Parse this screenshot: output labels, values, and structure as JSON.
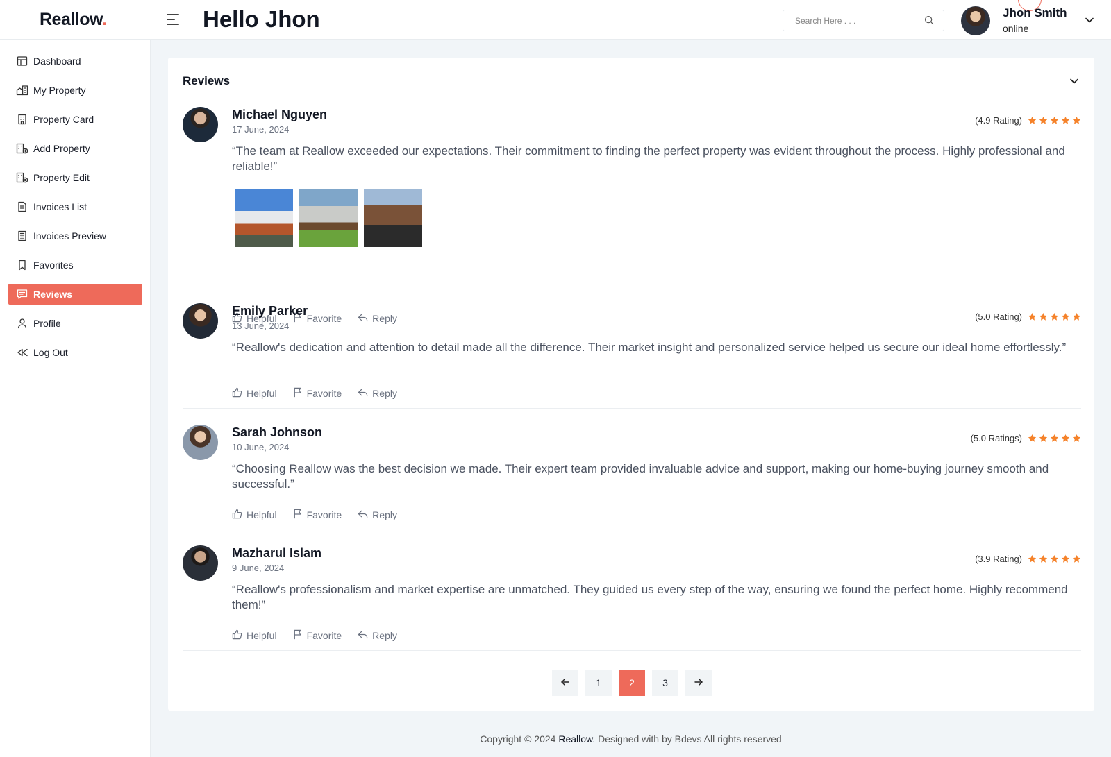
{
  "brand": {
    "name": "Reallow",
    "dot": ".",
    "accent": "#ee6a5a"
  },
  "header": {
    "title": "Hello Jhon",
    "search_placeholder": "Search Here . . .",
    "user_name": "Jhon Smith",
    "user_status": "online"
  },
  "sidebar": {
    "items": [
      {
        "label": "Dashboard",
        "icon": "dashboard-icon"
      },
      {
        "label": "My Property",
        "icon": "property-icon"
      },
      {
        "label": "Property Card",
        "icon": "building-icon"
      },
      {
        "label": "Add Property",
        "icon": "add-property-icon"
      },
      {
        "label": "Property Edit",
        "icon": "edit-property-icon"
      },
      {
        "label": "Invoices List",
        "icon": "invoice-icon"
      },
      {
        "label": "Invoices Preview",
        "icon": "invoice-preview-icon"
      },
      {
        "label": "Favorites",
        "icon": "bookmark-icon"
      },
      {
        "label": "Reviews",
        "icon": "review-icon",
        "active": true
      },
      {
        "label": "Profile",
        "icon": "user-icon"
      },
      {
        "label": "Log Out",
        "icon": "logout-icon"
      }
    ]
  },
  "reviews": {
    "title": "Reviews",
    "action_labels": {
      "helpful": "Helpful",
      "favorite": "Favorite",
      "reply": "Reply"
    },
    "items": [
      {
        "name": "Michael Nguyen",
        "date": "17 June, 2024",
        "rating_text": "(4.9 Rating)",
        "stars": 5,
        "text": "“The team at Reallow exceeded our expectations. Their commitment to finding the perfect property was evident throughout the process. Highly professional and reliable!”",
        "photos": 3
      },
      {
        "name": "Emily Parker",
        "date": "13 June, 2024",
        "rating_text": "(5.0 Rating)",
        "stars": 5,
        "text": "“Reallow's dedication and attention to detail made all the difference. Their market insight and personalized service helped us secure our ideal home effortlessly.”"
      },
      {
        "name": "Sarah Johnson",
        "date": "10 June, 2024",
        "rating_text": "(5.0 Ratings)",
        "stars": 5,
        "text": "“Choosing Reallow was the best decision we made. Their expert team provided invaluable advice and support, making our home-buying journey smooth and successful.”"
      },
      {
        "name": "Mazharul Islam",
        "date": "9 June, 2024",
        "rating_text": "(3.9 Rating)",
        "stars": 5,
        "text": "“Reallow's professionalism and market expertise are unmatched. They guided us every step of the way, ensuring we found the perfect home. Highly recommend them!”"
      }
    ]
  },
  "pagination": {
    "pages": [
      "1",
      "2",
      "3"
    ],
    "current": "2"
  },
  "footer": {
    "prefix": "Copyright © 2024",
    "brand": "Reallow.",
    "suffix": "Designed with by Bdevs All rights reserved"
  }
}
